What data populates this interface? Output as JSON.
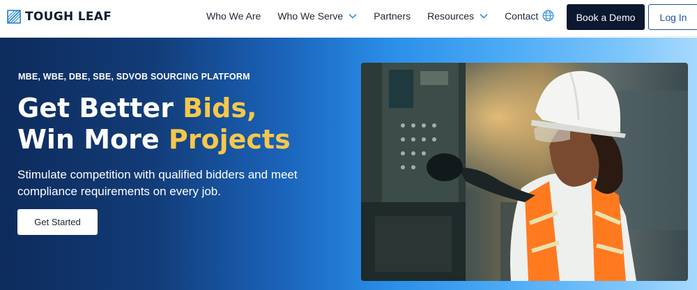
{
  "brand": {
    "name": "TOUGH LEAF"
  },
  "nav": {
    "items": [
      {
        "label": "Who We Are",
        "has_dropdown": false
      },
      {
        "label": "Who We Serve",
        "has_dropdown": true
      },
      {
        "label": "Partners",
        "has_dropdown": false
      },
      {
        "label": "Resources",
        "has_dropdown": true
      },
      {
        "label": "Contact",
        "has_dropdown": false
      }
    ],
    "language_icon": "globe-icon",
    "demo_label": "Book a Demo",
    "login_label": "Log In"
  },
  "hero": {
    "eyebrow": "MBE, WBE, DBE, SBE, SDVOB SOURCING PLATFORM",
    "headline_line1_prefix": "Get Better ",
    "headline_line1_accent": "Bids,",
    "headline_line2_prefix": "Win More ",
    "headline_line2_accent": "Projects",
    "subheadline": "Stimulate competition with qualified bidders and meet compliance requirements on every job.",
    "cta_label": "Get Started"
  },
  "colors": {
    "accent_yellow": "#f5c84c",
    "navy": "#0c1730",
    "link_blue": "#1f4ea8"
  }
}
